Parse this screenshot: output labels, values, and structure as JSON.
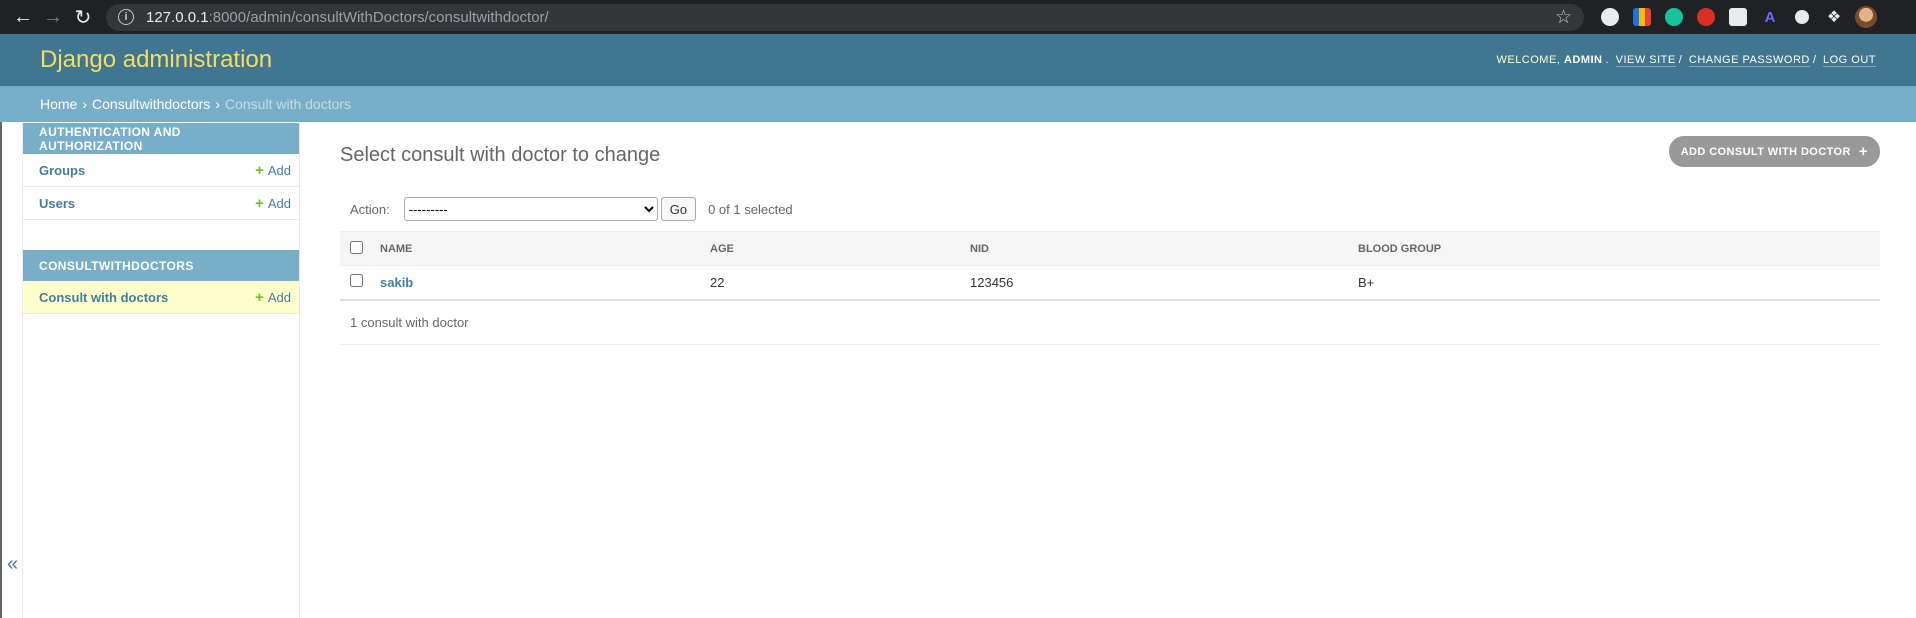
{
  "browser": {
    "url_host": "127.0.0.1",
    "url_rest": ":8000/admin/consultWithDoctors/consultwithdoctor/"
  },
  "header": {
    "branding": "Django administration",
    "welcome": "Welcome,",
    "username": "admin",
    "view_site": "View site",
    "change_password": "Change password",
    "log_out": "Log out"
  },
  "breadcrumbs": {
    "home": "Home",
    "app": "Consultwithdoctors",
    "current": "Consult with doctors"
  },
  "sidebar": {
    "modules": [
      {
        "caption": "Authentication and Authorization",
        "rows": [
          {
            "label": "Groups",
            "add": "Add"
          },
          {
            "label": "Users",
            "add": "Add"
          }
        ]
      },
      {
        "caption": "Consultwithdoctors",
        "rows": [
          {
            "label": "Consult with doctors",
            "add": "Add"
          }
        ]
      }
    ],
    "toggle": "«"
  },
  "content": {
    "title": "Select consult with doctor to change",
    "add_button": "Add consult with doctor",
    "action_label": "Action:",
    "action_default": "---------",
    "go_label": "Go",
    "selected_count": "0 of 1 selected",
    "columns": [
      "Name",
      "Age",
      "NID",
      "Blood group"
    ],
    "rows": [
      {
        "name": "sakib",
        "age": "22",
        "nid": "123456",
        "blood_group": "B+"
      }
    ],
    "paginator": "1 consult with doctor"
  },
  "colors": {
    "header_bg": "#417690",
    "breadcrumbs_bg": "#79aec8",
    "branding": "#f5dd5d",
    "link": "#447e9b",
    "add_plus": "#70bf2b",
    "current_row": "#ffffcc"
  }
}
